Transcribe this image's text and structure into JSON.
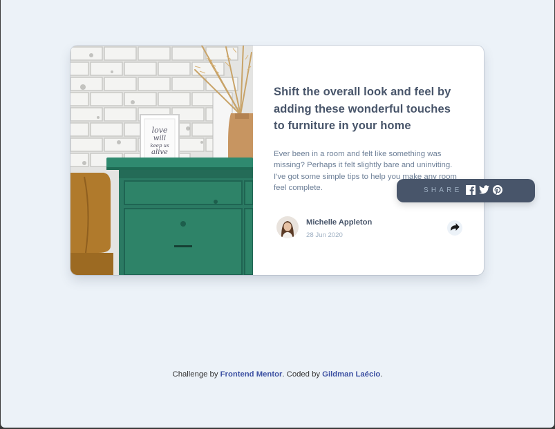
{
  "article": {
    "title": "Shift the overall look and feel by adding these wonderful touches to furniture in your home",
    "description": "Ever been in a room and felt like something was missing? Perhaps it felt slightly bare and uninviting. I've got some simple tips to help you make any room feel complete.",
    "image_alt": "Green drawers with a framed print reading love will keep us alive",
    "print_text": [
      "love",
      "will",
      "keep us",
      "alive"
    ]
  },
  "author": {
    "name": "Michelle Appleton",
    "date": "28 Jun 2020"
  },
  "share": {
    "label": "SHARE",
    "icons": [
      "facebook-icon",
      "twitter-icon",
      "pinterest-icon"
    ],
    "button_icon": "share-arrow-icon"
  },
  "attribution": {
    "prefix": "Challenge by ",
    "link1": "Frontend Mentor",
    "middle": ". Coded by ",
    "link2": "Gildman Laécio",
    "suffix": "."
  },
  "colors": {
    "background": "#ecf2f8",
    "card": "#ffffff",
    "heading": "#48556a",
    "body_text": "#6e8098",
    "muted": "#9eafc2",
    "share_bg": "#48556a",
    "link": "#3e52a3"
  }
}
